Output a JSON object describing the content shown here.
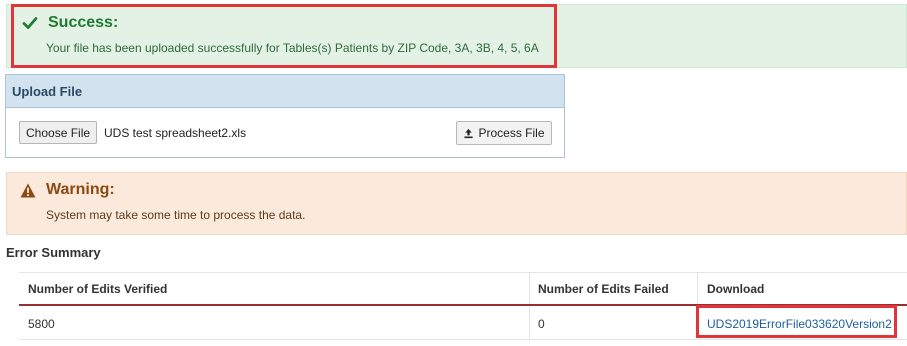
{
  "success": {
    "title": "Success:",
    "icon": "checkmark-icon",
    "message": "Your file has been uploaded successfully for Tables(s) Patients by ZIP Code, 3A, 3B, 4, 5, 6A"
  },
  "upload": {
    "header": "Upload File",
    "choose_label": "Choose File",
    "file_name": "UDS test spreadsheet2.xls",
    "process_label": "Process File",
    "process_icon": "upload-icon"
  },
  "warning": {
    "title": "Warning:",
    "icon": "warning-triangle-icon",
    "message": "System may take some time to process the data."
  },
  "error_summary": {
    "heading": "Error Summary",
    "columns": [
      "Number of Edits Verified",
      "Number of Edits Failed",
      "Download"
    ],
    "rows": [
      {
        "verified": "5800",
        "failed": "0",
        "download": "UDS2019ErrorFile033620Version2"
      }
    ]
  },
  "colors": {
    "success_bg": "#e4f2e6",
    "success_text": "#1f7a32",
    "warning_bg": "#fbeadc",
    "warning_text": "#8a4a12",
    "highlight": "#e0363b",
    "link": "#1d5e9a",
    "table_header_rule": "#9a2e2e"
  }
}
